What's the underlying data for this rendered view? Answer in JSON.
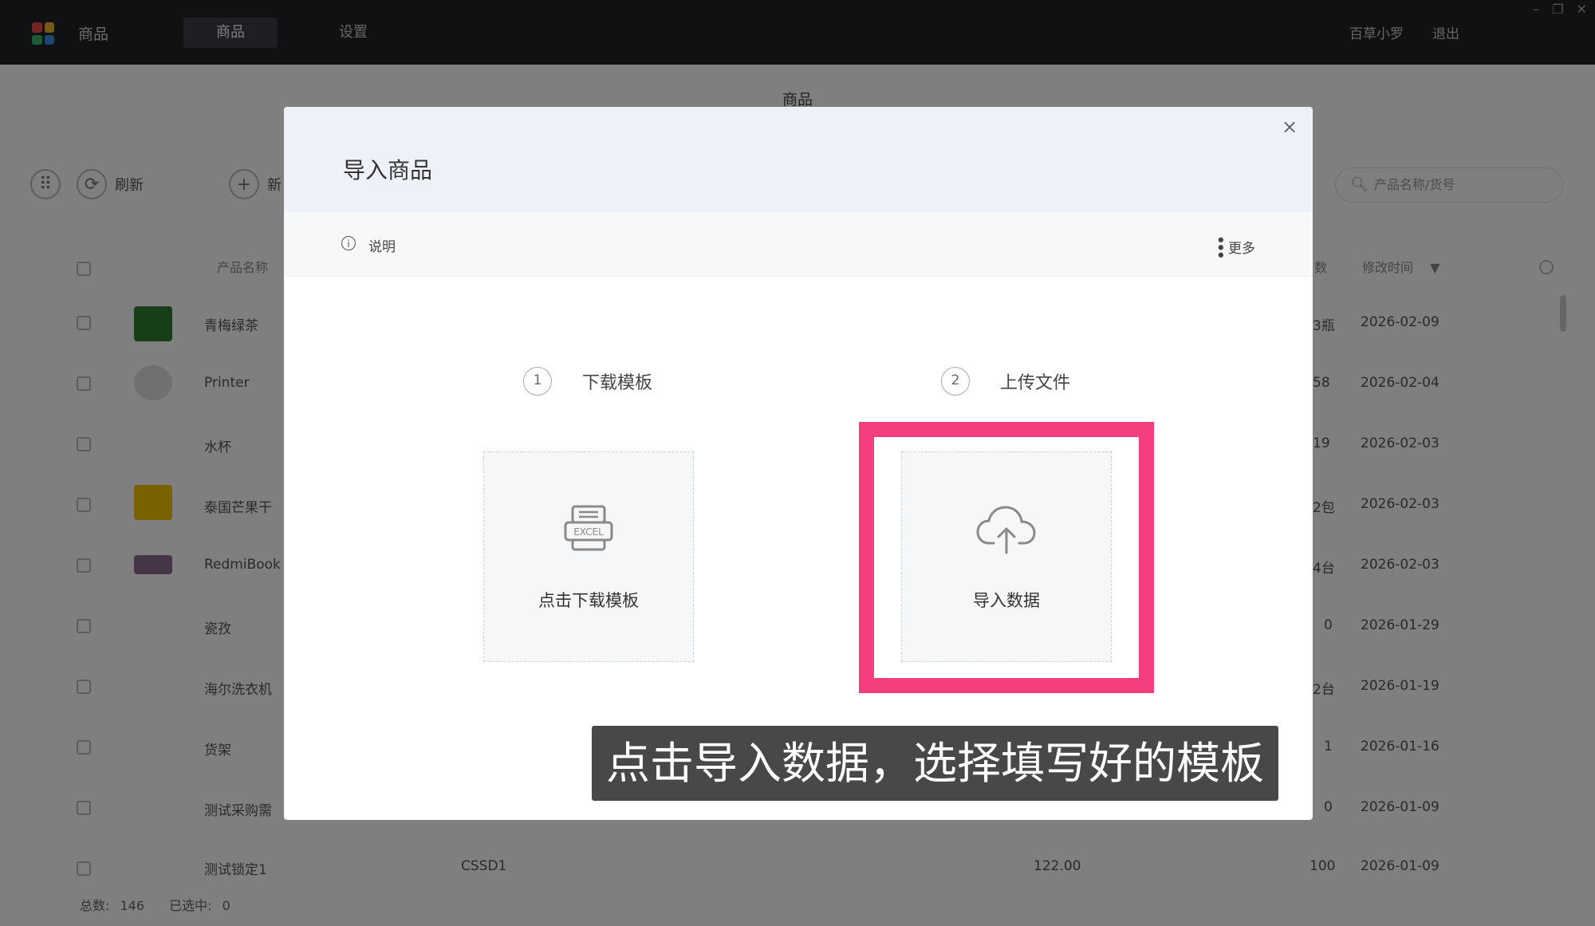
{
  "topbar": {
    "app_name": "商品",
    "nav": [
      {
        "label": "商品"
      },
      {
        "label": "设置"
      }
    ],
    "user": "百草小罗",
    "logout": "退出",
    "window_controls": [
      "–",
      "❐",
      "✕"
    ]
  },
  "page": {
    "title": "商品",
    "toolbar": {
      "refresh": "刷新",
      "add": "新"
    },
    "search_placeholder": "产品名称/货号",
    "columns": {
      "name": "产品名称",
      "stock": "数",
      "modified": "修改时间",
      "sort_icon": "▼"
    },
    "rows": [
      {
        "name": "青梅绿茶",
        "qty": "3瓶",
        "date": "2026-02-09"
      },
      {
        "name": "Printer",
        "qty": "58",
        "date": "2026-02-04"
      },
      {
        "name": "水杯",
        "qty": "19",
        "date": "2026-02-03"
      },
      {
        "name": "泰国芒果干",
        "qty": "2包",
        "date": "2026-02-03"
      },
      {
        "name": "RedmiBook",
        "qty": "4台",
        "date": "2026-02-03"
      },
      {
        "name": "瓷孜",
        "qty": "0",
        "date": "2026-01-29"
      },
      {
        "name": "海尔洗衣机",
        "qty": "2台",
        "date": "2026-01-19"
      },
      {
        "name": "货架",
        "qty": "1",
        "date": "2026-01-16"
      },
      {
        "name": "测试采购需",
        "qty": "0",
        "date": "2026-01-09"
      },
      {
        "name": "测试锁定1",
        "code": "CSSD1",
        "price": "122.00",
        "qty": "100",
        "date": "2026-01-09"
      }
    ],
    "footer": {
      "total_label": "总数:",
      "total": "146",
      "selected_label": "已选中:",
      "selected": "0"
    }
  },
  "modal": {
    "title": "导入商品",
    "close": "×",
    "info_icon": "i",
    "info_label": "说明",
    "more_label": "更多",
    "steps": [
      {
        "num": "1",
        "label": "下载模板",
        "card_label": "点击下载模板",
        "icon": "excel-icon",
        "icon_text": "EXCEL"
      },
      {
        "num": "2",
        "label": "上传文件",
        "card_label": "导入数据",
        "icon": "cloud-upload-icon"
      }
    ]
  },
  "highlight_color": "#f53e7e",
  "caption": "点击导入数据，选择填写好的模板"
}
